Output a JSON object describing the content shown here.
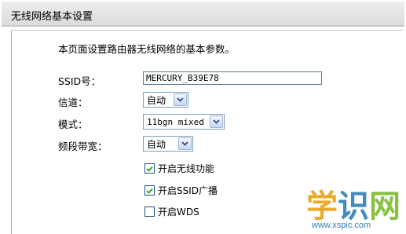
{
  "header": {
    "title": "无线网络基本设置"
  },
  "intro": "本页面设置路由器无线网络的基本参数。",
  "fields": {
    "ssid": {
      "label": "SSID号：",
      "value": "MERCURY_B39E78"
    },
    "channel": {
      "label": "信道：",
      "value": "自动"
    },
    "mode": {
      "label": "模式：",
      "value": "11bgn mixed"
    },
    "bandwidth": {
      "label": "频段带宽：",
      "value": "自动"
    }
  },
  "options": {
    "enable_wireless": {
      "label": "开启无线功能",
      "checked": true
    },
    "enable_ssid_broadcast": {
      "label": "开启SSID广播",
      "checked": true
    },
    "enable_wds": {
      "label": "开启WDS",
      "checked": false
    }
  },
  "watermark": {
    "text": "学识网",
    "url": "www.xspic.com",
    "colors": [
      "#e8a317",
      "#2e7fb8",
      "#7cba2f"
    ]
  }
}
